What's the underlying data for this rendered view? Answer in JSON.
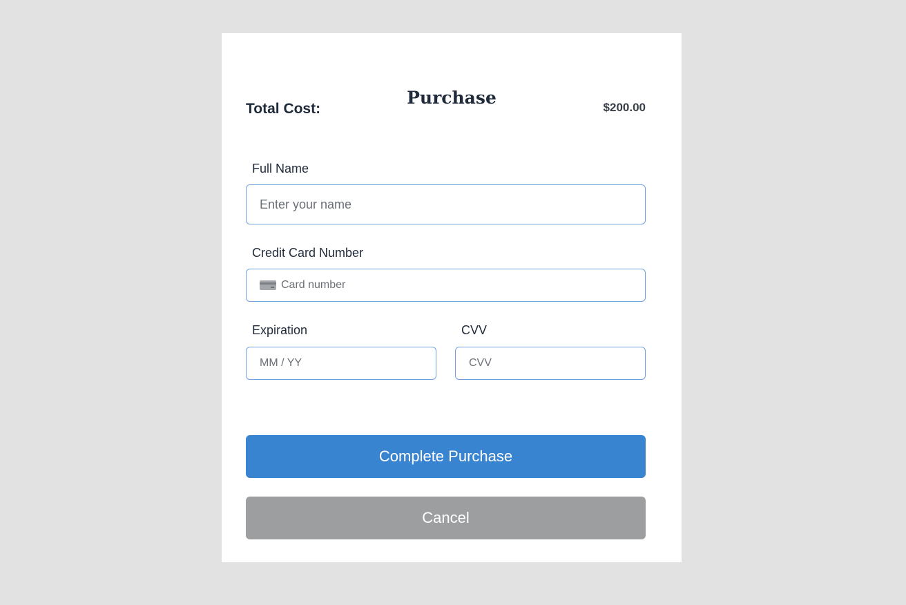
{
  "form": {
    "title": "Purchase",
    "total_label": "Total Cost:",
    "total_value": "$200.00",
    "full_name": {
      "label": "Full Name",
      "value": "",
      "placeholder": "Enter your name"
    },
    "card_number": {
      "label": "Credit Card Number",
      "value": "",
      "placeholder": "Card number",
      "icon": "credit-card-icon"
    },
    "expiration": {
      "label": "Expiration",
      "value": "",
      "placeholder": "MM / YY"
    },
    "cvv": {
      "label": "CVV",
      "value": "",
      "placeholder": "CVV"
    },
    "buttons": {
      "complete": "Complete Purchase",
      "cancel": "Cancel"
    }
  },
  "colors": {
    "page_background": "#e2e2e2",
    "card_background": "#ffffff",
    "input_border": "#6fa0e0",
    "primary_button": "#3884d0",
    "secondary_button": "#9d9ea0",
    "text": "#1f2a3a"
  }
}
